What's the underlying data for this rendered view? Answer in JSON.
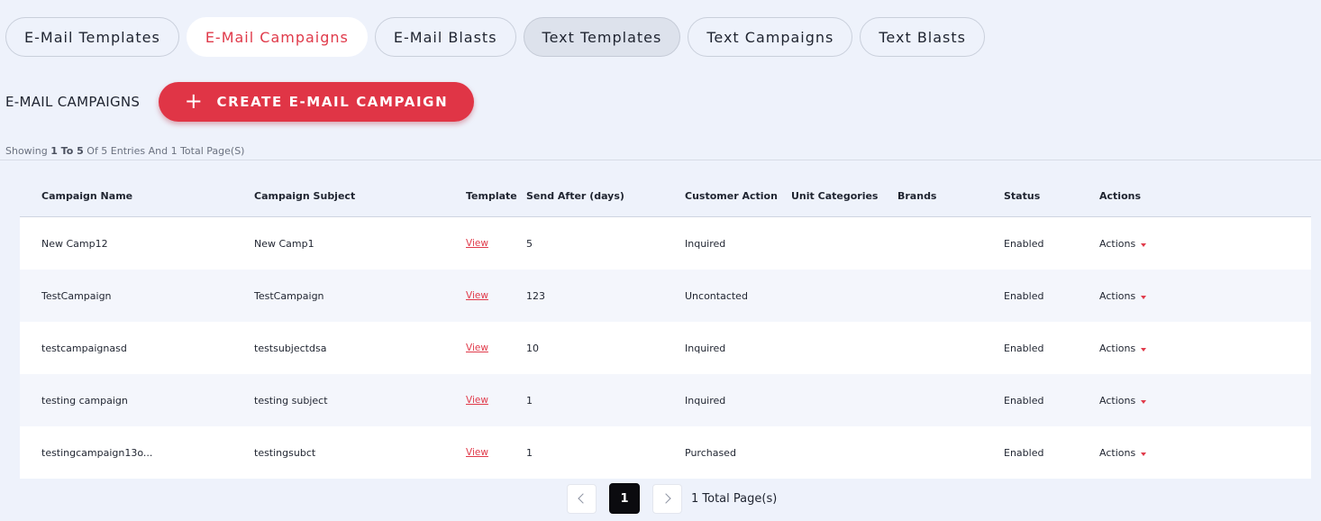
{
  "tabs": [
    {
      "label": "E-Mail Templates",
      "state": "default"
    },
    {
      "label": "E-Mail Campaigns",
      "state": "active"
    },
    {
      "label": "E-Mail Blasts",
      "state": "default"
    },
    {
      "label": "Text Templates",
      "state": "hovered"
    },
    {
      "label": "Text Campaigns",
      "state": "default"
    },
    {
      "label": "Text Blasts",
      "state": "default"
    }
  ],
  "section": {
    "title": "E-MAIL CAMPAIGNS",
    "create_button": "CREATE E-MAIL CAMPAIGN",
    "create_icon": "+"
  },
  "showing": {
    "prefix": "Showing",
    "range": "1 To 5",
    "suffix": "Of 5 Entries And 1 Total Page(S)"
  },
  "table": {
    "headers": [
      "Campaign Name",
      "Campaign Subject",
      "Template",
      "Send After (days)",
      "Customer Action",
      "Unit Categories",
      "Brands",
      "Status",
      "Actions"
    ],
    "rows": [
      {
        "name": "New Camp12",
        "subject": "New Camp1",
        "template": "View",
        "send_after": "5",
        "customer_action": "Inquired",
        "unit_categories": "",
        "brands": "",
        "status": "Enabled",
        "actions": "Actions"
      },
      {
        "name": "TestCampaign",
        "subject": "TestCampaign",
        "template": "View",
        "send_after": "123",
        "customer_action": "Uncontacted",
        "unit_categories": "",
        "brands": "",
        "status": "Enabled",
        "actions": "Actions"
      },
      {
        "name": "testcampaignasd",
        "subject": "testsubjectdsa",
        "template": "View",
        "send_after": "10",
        "customer_action": "Inquired",
        "unit_categories": "",
        "brands": "",
        "status": "Enabled",
        "actions": "Actions"
      },
      {
        "name": "testing campaign",
        "subject": "testing subject",
        "template": "View",
        "send_after": "1",
        "customer_action": "Inquired",
        "unit_categories": "",
        "brands": "",
        "status": "Enabled",
        "actions": "Actions"
      },
      {
        "name": "testingcampaign13o...",
        "subject": "testingsubct",
        "template": "View",
        "send_after": "1",
        "customer_action": "Purchased",
        "unit_categories": "",
        "brands": "",
        "status": "Enabled",
        "actions": "Actions"
      }
    ]
  },
  "pagination": {
    "current_page": "1",
    "total_label": "1 Total Page(s)"
  },
  "colors": {
    "accent": "#e03546",
    "background": "#eef2fb",
    "current_page_bg": "#0b0b0f"
  }
}
